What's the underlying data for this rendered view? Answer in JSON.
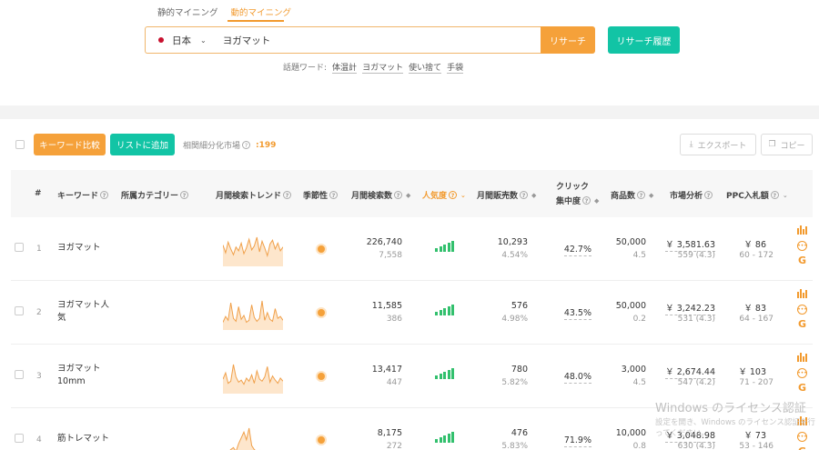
{
  "search": {
    "tabs": [
      {
        "label": "静的マイニング",
        "active": false
      },
      {
        "label": "動的マイニング",
        "active": true
      }
    ],
    "country": "日本",
    "query": "ヨガマット",
    "research_label": "リサーチ",
    "history_label": "リサーチ履歴",
    "topics_label": "話題ワード:",
    "topics": [
      "体温計",
      "ヨガマット",
      "使い捨て",
      "手袋"
    ]
  },
  "toolbar": {
    "compare_label": "キーワード比較",
    "add_list_label": "リストに追加",
    "related_label": "相関細分化市場",
    "related_count": ":199",
    "export_label": "エクスポート",
    "copy_label": "コピー"
  },
  "columns": {
    "index": "#",
    "keyword": "キーワード",
    "category": "所属カテゴリー",
    "trend": "月間検索トレンド",
    "seasonality": "季節性",
    "searches": "月間検索数",
    "popularity": "人気度",
    "sales": "月間販売数",
    "click_1": "クリック",
    "click_2": "集中度",
    "products": "商品数",
    "market": "市場分析",
    "ppc": "PPC入札額"
  },
  "colors": {
    "accent_orange": "#f5a13a",
    "accent_teal": "#12c4a5",
    "bar_green": "#32c06d"
  },
  "rows": [
    {
      "index": "1",
      "keyword": "ヨガマット",
      "searches": "226,740",
      "searches_sub": "7,558",
      "sales": "10,293",
      "sales_sub": "4.54%",
      "click": "42.7%",
      "products": "50,000",
      "products_sub": "4.5",
      "market": "￥ 3,581.63",
      "market_sub": "559 (4.3)",
      "ppc": "￥ 86",
      "ppc_sub": "60 - 172",
      "trend": [
        22,
        14,
        25,
        18,
        12,
        20,
        16,
        24,
        13,
        19,
        28,
        17,
        21,
        30,
        15,
        26,
        19,
        11,
        23,
        27,
        18,
        24,
        16,
        20
      ]
    },
    {
      "index": "2",
      "keyword": "ヨガマット人気",
      "searches": "11,585",
      "searches_sub": "386",
      "sales": "576",
      "sales_sub": "4.98%",
      "click": "43.5%",
      "products": "50,000",
      "products_sub": "0.2",
      "market": "￥ 3,242.23",
      "market_sub": "531 (4.3)",
      "ppc": "￥ 83",
      "ppc_sub": "64 - 167",
      "trend": [
        8,
        14,
        10,
        28,
        12,
        9,
        24,
        11,
        15,
        8,
        10,
        26,
        13,
        9,
        12,
        30,
        10,
        18,
        11,
        9,
        22,
        12,
        14,
        10
      ]
    },
    {
      "index": "3",
      "keyword": "ヨガマット 10mm",
      "searches": "13,417",
      "searches_sub": "447",
      "sales": "780",
      "sales_sub": "5.82%",
      "click": "48.0%",
      "products": "3,000",
      "products_sub": "4.5",
      "market": "￥ 2,674.44",
      "market_sub": "547 (4.2)",
      "ppc": "￥ 103",
      "ppc_sub": "71 - 207",
      "trend": [
        14,
        20,
        10,
        12,
        28,
        16,
        11,
        13,
        9,
        15,
        12,
        18,
        10,
        22,
        14,
        12,
        16,
        26,
        11,
        17,
        13,
        10,
        15,
        12
      ]
    },
    {
      "index": "4",
      "keyword": "筋トレマット",
      "searches": "8,175",
      "searches_sub": "272",
      "sales": "476",
      "sales_sub": "5.83%",
      "click": "71.9%",
      "products": "10,000",
      "products_sub": "0.8",
      "market": "￥ 3,048.98",
      "market_sub": "630 (4.3)",
      "ppc": "￥ 73",
      "ppc_sub": "53 - 146",
      "trend": [
        4,
        6,
        5,
        8,
        10,
        6,
        14,
        20,
        26,
        18,
        30,
        12,
        8,
        6,
        7,
        5,
        4,
        6,
        5,
        4,
        6,
        5,
        4,
        5
      ]
    }
  ],
  "watermark": {
    "title": "Windows のライセンス認証",
    "sub": "設定を開き、Windows のライセンス認証を行ってください。"
  }
}
